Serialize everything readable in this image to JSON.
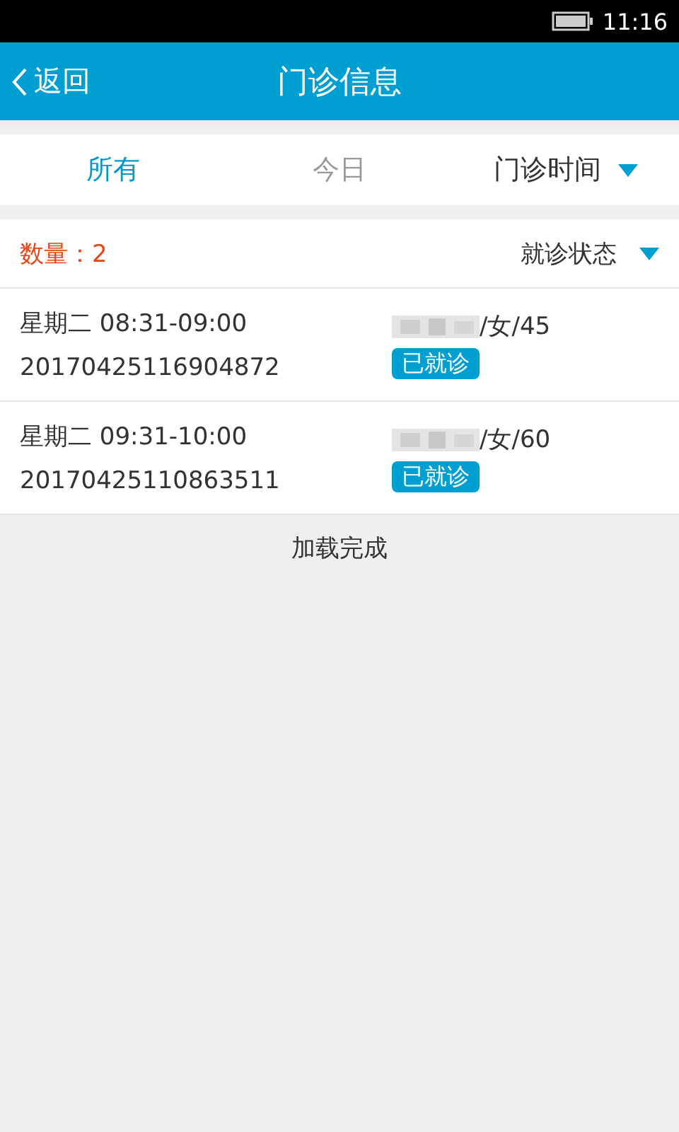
{
  "status_bar": {
    "time": "11:16"
  },
  "header": {
    "back": "返回",
    "title": "门诊信息"
  },
  "tabs": [
    {
      "label": "所有",
      "kind": "tab",
      "selected": true
    },
    {
      "label": "今日",
      "kind": "tab",
      "selected": false
    },
    {
      "label": "门诊时间",
      "kind": "dropdown",
      "selected": false
    }
  ],
  "summary": {
    "count": "数量：2",
    "filter": "就诊状态"
  },
  "records": [
    {
      "time": "星期二 08:31-09:00",
      "number": "20170425116904872",
      "patient": "/女/45",
      "status": "已就诊"
    },
    {
      "time": "星期二 09:31-10:00",
      "number": "20170425110863511",
      "patient": "/女/60",
      "status": "已就诊"
    }
  ],
  "footer": "加载完成"
}
